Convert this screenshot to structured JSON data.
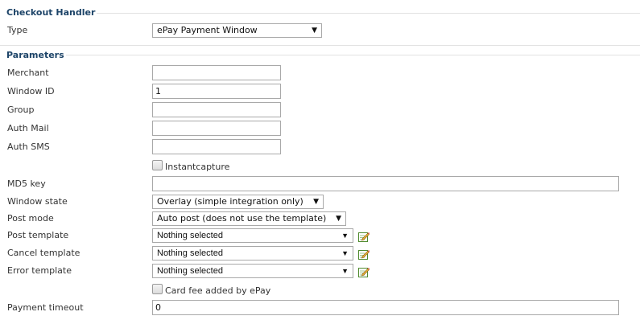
{
  "checkout_handler": {
    "title": "Checkout Handler",
    "type_label": "Type",
    "type_value": "ePay Payment Window"
  },
  "parameters": {
    "title": "Parameters",
    "merchant": {
      "label": "Merchant",
      "value": ""
    },
    "window_id": {
      "label": "Window ID",
      "value": "1"
    },
    "group": {
      "label": "Group",
      "value": ""
    },
    "auth_mail": {
      "label": "Auth Mail",
      "value": ""
    },
    "auth_sms": {
      "label": "Auth SMS",
      "value": ""
    },
    "instantcapture": {
      "label": "Instantcapture",
      "checked": false
    },
    "md5_key": {
      "label": "MD5 key",
      "value": ""
    },
    "window_state": {
      "label": "Window state",
      "value": "Overlay (simple integration only)"
    },
    "post_mode": {
      "label": "Post mode",
      "value": "Auto post (does not use the template)"
    },
    "post_template": {
      "label": "Post template",
      "value": "Nothing selected"
    },
    "cancel_template": {
      "label": "Cancel template",
      "value": "Nothing selected"
    },
    "error_template": {
      "label": "Error template",
      "value": "Nothing selected"
    },
    "card_fee": {
      "label": "Card fee added by ePay",
      "checked": false
    },
    "payment_timeout": {
      "label": "Payment timeout",
      "value": "0"
    }
  },
  "icons": {
    "edit": "edit-pencil-icon"
  },
  "colors": {
    "section_title": "#1d4468",
    "rule": "#e2e2e2",
    "border": "#a9a9a9"
  }
}
